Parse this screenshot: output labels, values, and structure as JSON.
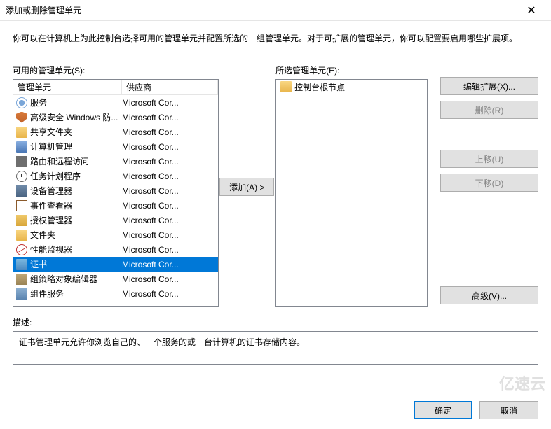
{
  "window": {
    "title": "添加或删除管理单元"
  },
  "instruction": "你可以在计算机上为此控制台选择可用的管理单元并配置所选的一组管理单元。对于可扩展的管理单元，你可以配置要启用哪些扩展项。",
  "available": {
    "label": "可用的管理单元(S):",
    "columns": {
      "name": "管理单元",
      "vendor": "供应商"
    },
    "items": [
      {
        "icon": "gear-icon",
        "name": "服务",
        "vendor": "Microsoft Cor..."
      },
      {
        "icon": "shield-icon",
        "name": "高级安全 Windows 防...",
        "vendor": "Microsoft Cor..."
      },
      {
        "icon": "folder-icon",
        "name": "共享文件夹",
        "vendor": "Microsoft Cor..."
      },
      {
        "icon": "computer-icon",
        "name": "计算机管理",
        "vendor": "Microsoft Cor..."
      },
      {
        "icon": "route-icon",
        "name": "路由和远程访问",
        "vendor": "Microsoft Cor..."
      },
      {
        "icon": "clock-icon",
        "name": "任务计划程序",
        "vendor": "Microsoft Cor..."
      },
      {
        "icon": "device-icon",
        "name": "设备管理器",
        "vendor": "Microsoft Cor..."
      },
      {
        "icon": "event-icon",
        "name": "事件查看器",
        "vendor": "Microsoft Cor..."
      },
      {
        "icon": "auth-icon",
        "name": "授权管理器",
        "vendor": "Microsoft Cor..."
      },
      {
        "icon": "folder2-icon",
        "name": "文件夹",
        "vendor": "Microsoft Cor..."
      },
      {
        "icon": "perf-icon",
        "name": "性能监视器",
        "vendor": "Microsoft Cor..."
      },
      {
        "icon": "cert-icon",
        "name": "证书",
        "vendor": "Microsoft Cor...",
        "selected": true
      },
      {
        "icon": "gpo-icon",
        "name": "组策略对象编辑器",
        "vendor": "Microsoft Cor..."
      },
      {
        "icon": "compsvc-icon",
        "name": "组件服务",
        "vendor": "Microsoft Cor..."
      }
    ]
  },
  "selected": {
    "label": "所选管理单元(E):",
    "root": "控制台根节点"
  },
  "buttons": {
    "add": "添加(A) >",
    "edit_ext": "编辑扩展(X)...",
    "remove": "删除(R)",
    "move_up": "上移(U)",
    "move_down": "下移(D)",
    "advanced": "高级(V)...",
    "ok": "确定",
    "cancel": "取消"
  },
  "description": {
    "label": "描述:",
    "text": "证书管理单元允许你浏览自己的、一个服务的或一台计算机的证书存储内容。"
  },
  "watermark": "亿速云"
}
